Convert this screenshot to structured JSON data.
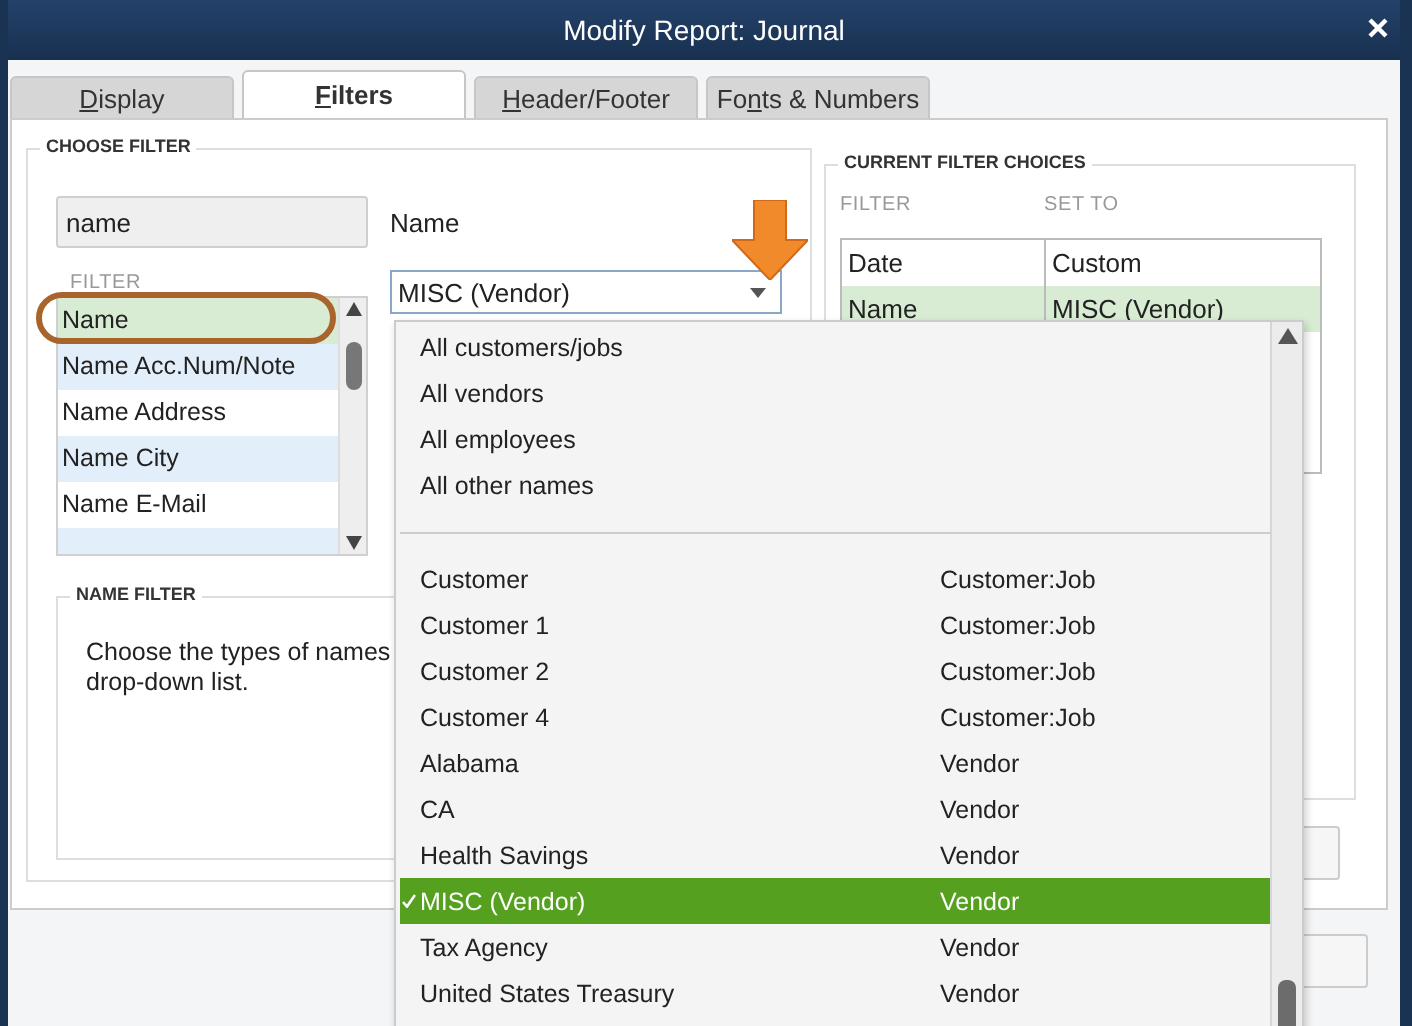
{
  "window": {
    "title": "Modify Report: Journal"
  },
  "tabs": [
    {
      "access_key": "D",
      "rest": "isplay",
      "selected": false
    },
    {
      "access_key": "F",
      "rest": "ilters",
      "selected": true
    },
    {
      "access_key": "H",
      "rest": "eader/Footer",
      "selected": false
    },
    {
      "before": "Fo",
      "access_key": "n",
      "rest": "ts & Numbers",
      "selected": false
    }
  ],
  "choose_filter": {
    "title": "CHOOSE FILTER",
    "search": {
      "value": "name"
    },
    "list_header": "FILTER",
    "items": [
      {
        "label": "Name",
        "selected": true
      },
      {
        "label": "Name Acc.Num/Note",
        "selected": false
      },
      {
        "label": "Name Address",
        "selected": false
      },
      {
        "label": "Name City",
        "selected": false
      },
      {
        "label": "Name E-Mail",
        "selected": false
      }
    ],
    "field_label": "Name",
    "dropdown": {
      "value": "MISC (Vendor)"
    }
  },
  "name_filter": {
    "title": "NAME FILTER",
    "lines": [
      "Choose the types of names",
      "drop-down list."
    ]
  },
  "current_filter_choices": {
    "title": "CURRENT FILTER CHOICES",
    "columns": [
      "FILTER",
      "SET TO"
    ],
    "rows": [
      {
        "filter": "Date",
        "set_to": "Custom",
        "selected": false
      },
      {
        "filter": "Name",
        "set_to": "MISC (Vendor)",
        "selected": true
      }
    ]
  },
  "dropdown_list": {
    "groups": [
      "All customers/jobs",
      "All vendors",
      "All employees",
      "All other names"
    ],
    "names": [
      {
        "name": "Customer",
        "type": "Customer:Job",
        "selected": false
      },
      {
        "name": "Customer 1",
        "type": "Customer:Job",
        "selected": false
      },
      {
        "name": "Customer 2",
        "type": "Customer:Job",
        "selected": false
      },
      {
        "name": "Customer 4",
        "type": "Customer:Job",
        "selected": false
      },
      {
        "name": "Alabama",
        "type": "Vendor",
        "selected": false
      },
      {
        "name": "CA",
        "type": "Vendor",
        "selected": false
      },
      {
        "name": "Health Savings",
        "type": "Vendor",
        "selected": false
      },
      {
        "name": "MISC (Vendor)",
        "type": "Vendor",
        "selected": true
      },
      {
        "name": "Tax Agency",
        "type": "Vendor",
        "selected": false
      },
      {
        "name": "United States Treasury",
        "type": "Vendor",
        "selected": false
      }
    ]
  }
}
